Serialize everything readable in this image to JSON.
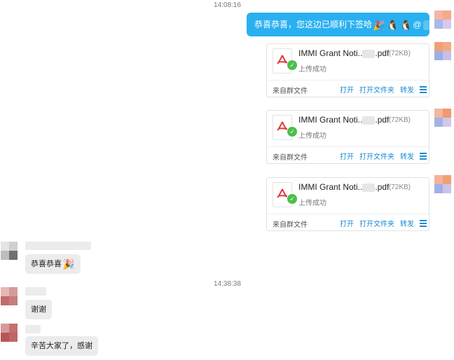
{
  "timestamps": [
    "14:08:16",
    "14:38:38"
  ],
  "outgoing": {
    "text": "恭喜恭喜，您这边已顺利下签哈",
    "emojis": [
      "🎉",
      "🐧",
      "🐧"
    ],
    "mention": "@"
  },
  "files": [
    {
      "name": "IMMI Grant Noti..",
      "ext": ".pdf",
      "size": "(72KB)",
      "status": "上传成功",
      "source": "来自群文件"
    },
    {
      "name": "IMMI Grant Noti..",
      "ext": ".pdf",
      "size": "(72KB)",
      "status": "上传成功",
      "source": "来自群文件"
    },
    {
      "name": "IMMI Grant Noti..",
      "ext": ".pdf",
      "size": "(72KB)",
      "status": "上传成功",
      "source": "来自群文件"
    }
  ],
  "file_actions": {
    "open": "打开",
    "open_folder": "打开文件夹",
    "forward": "转发"
  },
  "incoming": [
    {
      "text": "恭喜恭喜",
      "emoji": "🎉"
    },
    {
      "text": "谢谢",
      "emoji": ""
    },
    {
      "text": "辛苦大家了，感谢",
      "emoji": ""
    }
  ],
  "colors": {
    "outgoing_bubble": "#2ab0f0",
    "link": "#1a8ad4",
    "incoming_bubble": "#ececec",
    "success": "#4bbf4b"
  }
}
